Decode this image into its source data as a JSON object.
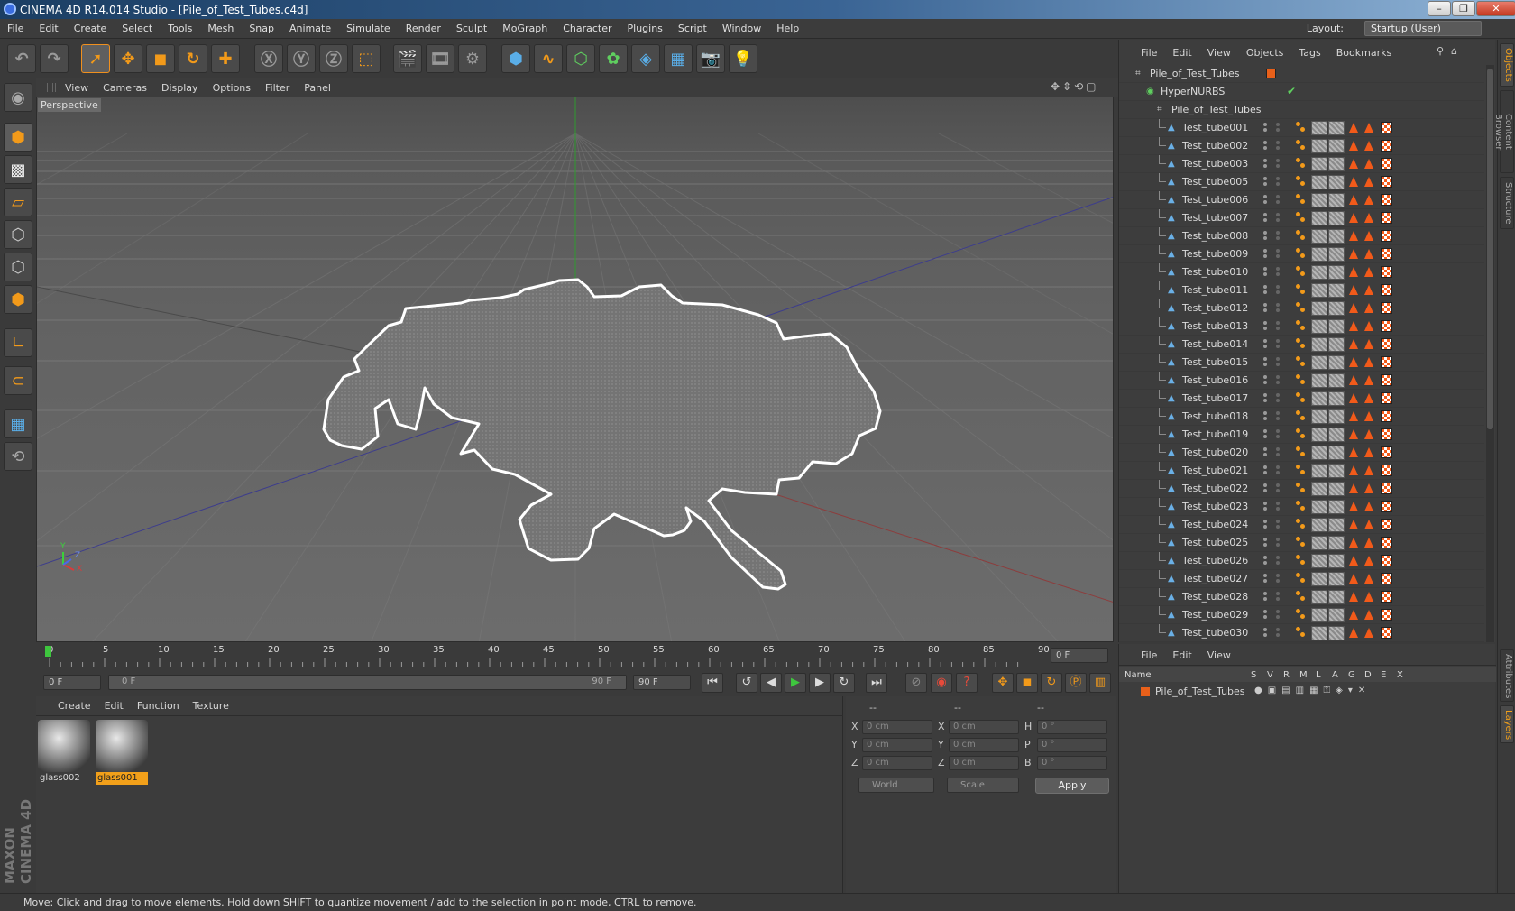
{
  "window": {
    "title": "CINEMA 4D R14.014 Studio - [Pile_of_Test_Tubes.c4d]",
    "controls": [
      "–",
      "❐",
      "✕"
    ]
  },
  "menubar": {
    "items": [
      "File",
      "Edit",
      "Create",
      "Select",
      "Tools",
      "Mesh",
      "Snap",
      "Animate",
      "Simulate",
      "Render",
      "Sculpt",
      "MoGraph",
      "Character",
      "Plugins",
      "Script",
      "Window",
      "Help"
    ],
    "layout_label": "Layout:",
    "layout_value": "Startup (User)"
  },
  "viewport": {
    "menu": [
      "View",
      "Cameras",
      "Display",
      "Options",
      "Filter",
      "Panel"
    ],
    "label": "Perspective",
    "axes": {
      "y": "Y",
      "z": "Z",
      "x": "X"
    }
  },
  "timeline": {
    "ticks": [
      "0",
      "5",
      "10",
      "15",
      "20",
      "25",
      "30",
      "35",
      "40",
      "45",
      "50",
      "55",
      "60",
      "65",
      "70",
      "75",
      "80",
      "85",
      "90"
    ],
    "current_frame": "0 F",
    "start_field": "0 F",
    "slider_start": "0 F",
    "slider_end": "90 F",
    "end_field": "90 F"
  },
  "materials": {
    "menu": [
      "Create",
      "Edit",
      "Function",
      "Texture"
    ],
    "items": [
      {
        "name": "glass002",
        "selected": false
      },
      {
        "name": "glass001",
        "selected": true
      }
    ]
  },
  "coordinates": {
    "header": [
      "--",
      "--",
      "--"
    ],
    "rows": [
      {
        "a": "X",
        "av": "0 cm",
        "b": "X",
        "bv": "0 cm",
        "c": "H",
        "cv": "0 °"
      },
      {
        "a": "Y",
        "av": "0 cm",
        "b": "Y",
        "bv": "0 cm",
        "c": "P",
        "cv": "0 °"
      },
      {
        "a": "Z",
        "av": "0 cm",
        "b": "Z",
        "bv": "0 cm",
        "c": "B",
        "cv": "0 °"
      }
    ],
    "mode1": "World",
    "mode2": "Scale",
    "apply": "Apply"
  },
  "objects": {
    "menu": [
      "File",
      "Edit",
      "View",
      "Objects",
      "Tags",
      "Bookmarks"
    ],
    "root": "Pile_of_Test_Tubes",
    "hypernurbs": "HyperNURBS",
    "group": "Pile_of_Test_Tubes",
    "tubes": [
      "Test_tube001",
      "Test_tube002",
      "Test_tube003",
      "Test_tube005",
      "Test_tube006",
      "Test_tube007",
      "Test_tube008",
      "Test_tube009",
      "Test_tube010",
      "Test_tube011",
      "Test_tube012",
      "Test_tube013",
      "Test_tube014",
      "Test_tube015",
      "Test_tube016",
      "Test_tube017",
      "Test_tube018",
      "Test_tube019",
      "Test_tube020",
      "Test_tube021",
      "Test_tube022",
      "Test_tube023",
      "Test_tube024",
      "Test_tube025",
      "Test_tube026",
      "Test_tube027",
      "Test_tube028",
      "Test_tube029",
      "Test_tube030"
    ]
  },
  "side_tabs": {
    "top": [
      "Objects",
      "Content Browser",
      "Structure"
    ],
    "bottom": [
      "Attributes",
      "Layers"
    ]
  },
  "layers": {
    "menu": [
      "File",
      "Edit",
      "View"
    ],
    "columns": [
      "Name",
      "S",
      "V",
      "R",
      "M",
      "L",
      "A",
      "G",
      "D",
      "E",
      "X"
    ],
    "row": "Pile_of_Test_Tubes"
  },
  "brand": {
    "text": "MAXON CINEMA 4D"
  },
  "status": {
    "text": "Move: Click and drag to move elements. Hold down SHIFT to quantize movement / add to the selection in point mode, CTRL to remove."
  },
  "colors": {
    "accent": "#f29a1a",
    "selection": "#f2a01a",
    "background": "#3a3a3a"
  }
}
